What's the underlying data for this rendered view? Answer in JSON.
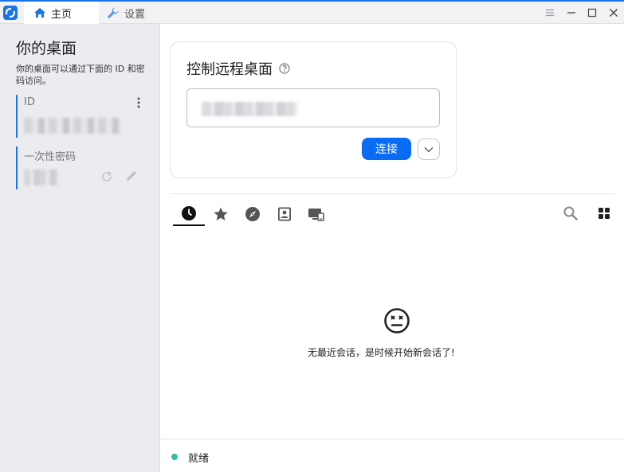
{
  "titlebar": {
    "tabs": [
      {
        "label": "主页",
        "icon": "home-icon"
      },
      {
        "label": "设置",
        "icon": "wrench-icon"
      }
    ],
    "window_controls": [
      "menu-icon",
      "minimize-icon",
      "maximize-icon",
      "close-icon"
    ]
  },
  "sidebar": {
    "title": "你的桌面",
    "description": "你的桌面可以通过下面的 ID 和密码访问。",
    "id_label": "ID",
    "password_label": "一次性密码"
  },
  "connect": {
    "title": "控制远程桌面",
    "button_label": "连接"
  },
  "peers": {
    "tabs": [
      "recent-sessions-icon",
      "favorites-icon",
      "discovered-icon",
      "address-book-icon",
      "device-group-icon"
    ],
    "empty_message": "无最近会话，是时候开始新会话了!"
  },
  "status": {
    "text": "就绪",
    "color": "#32bea6"
  },
  "colors": {
    "accent": "#1a73e8",
    "button": "#0a6cf5"
  }
}
